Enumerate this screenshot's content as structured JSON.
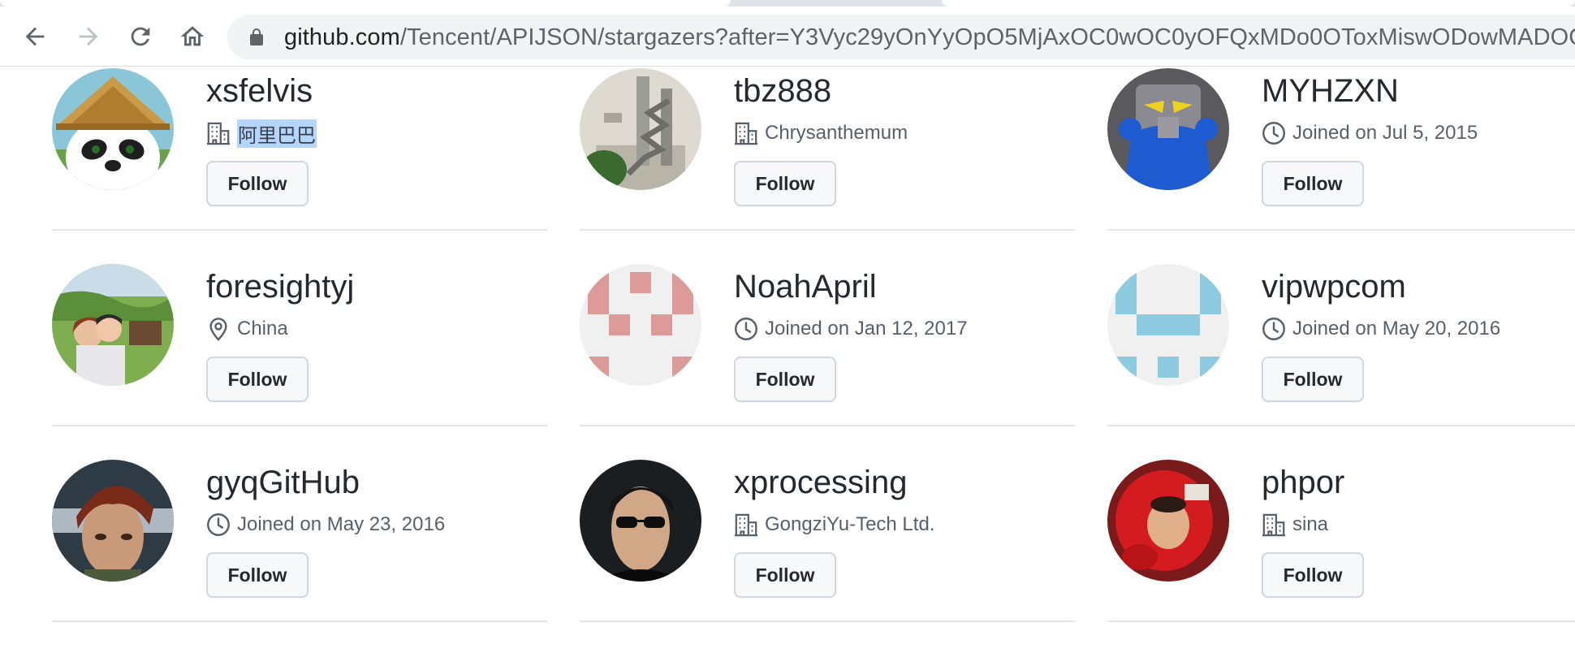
{
  "browser": {
    "url_host": "github.com",
    "url_path": "/Tencent/APIJSON/stargazers?after=Y3Vyc29yOnYyOpO5MjAxOC0wOC0yOFQxMDo0OToxMiswODowMADOC",
    "icons": {
      "back": "arrow-left-icon",
      "forward": "arrow-right-icon",
      "reload": "reload-icon",
      "home": "home-icon",
      "lock": "lock-icon"
    }
  },
  "users": [
    {
      "username": "xsfelvis",
      "meta_icon": "organization-icon",
      "meta_text": "阿里巴巴",
      "meta_selected": true,
      "follow_label": "Follow",
      "avatar": "panda-avatar"
    },
    {
      "username": "tbz888",
      "meta_icon": "organization-icon",
      "meta_text": "Chrysanthemum",
      "follow_label": "Follow",
      "avatar": "stairs-avatar"
    },
    {
      "username": "MYHZXN",
      "meta_icon": "clock-icon",
      "meta_text": "Joined on Jul 5, 2015",
      "follow_label": "Follow",
      "avatar": "robot-avatar"
    },
    {
      "username": "foresightyj",
      "meta_icon": "location-icon",
      "meta_text": "China",
      "follow_label": "Follow",
      "avatar": "photo-avatar"
    },
    {
      "username": "NoahApril",
      "meta_icon": "clock-icon",
      "meta_text": "Joined on Jan 12, 2017",
      "follow_label": "Follow",
      "avatar": "identicon-avatar",
      "identicon_color": "#dc9a98"
    },
    {
      "username": "vipwpcom",
      "meta_icon": "clock-icon",
      "meta_text": "Joined on May 20, 2016",
      "follow_label": "Follow",
      "avatar": "identicon-avatar",
      "identicon_color": "#8ecae0"
    },
    {
      "username": "gyqGitHub",
      "meta_icon": "clock-icon",
      "meta_text": "Joined on May 23, 2016",
      "follow_label": "Follow",
      "avatar": "anime-avatar"
    },
    {
      "username": "xprocessing",
      "meta_icon": "organization-icon",
      "meta_text": "GongziYu-Tech Ltd.",
      "follow_label": "Follow",
      "avatar": "sunglasses-avatar"
    },
    {
      "username": "phpor",
      "meta_icon": "organization-icon",
      "meta_text": "sina",
      "follow_label": "Follow",
      "avatar": "red-photo-avatar"
    }
  ]
}
